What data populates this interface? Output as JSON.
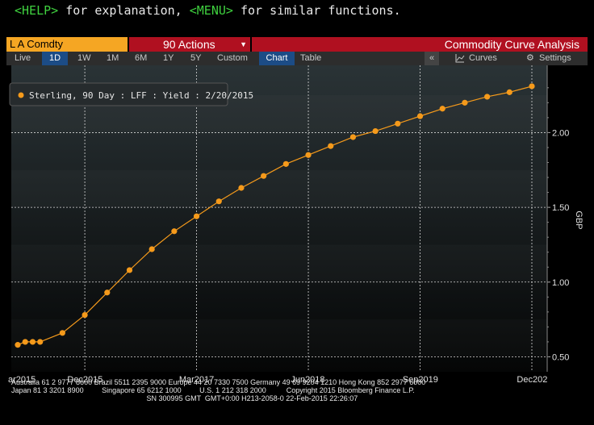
{
  "help_bar": {
    "help_key": "<HELP>",
    "help_text": " for explanation, ",
    "menu_key": "<MENU>",
    "menu_text": " for similar functions."
  },
  "header": {
    "ticker": "L A Comdty",
    "actions_num": "90",
    "actions_label": "Actions",
    "title": "Commodity Curve Analysis"
  },
  "toolbar": {
    "ranges": [
      "Live",
      "1D",
      "1W",
      "1M",
      "6M",
      "1Y",
      "5Y",
      "Custom"
    ],
    "active_range": "1D",
    "chart_label": "Chart",
    "table_label": "Table",
    "collapse_label": "«",
    "curves_label": "Curves",
    "settings_label": "Settings"
  },
  "legend": {
    "label": "Sterling, 90 Day : LFF : Yield : 2/20/2015"
  },
  "chart_data": {
    "type": "line",
    "ylabel": "GBP",
    "ylim": [
      0.4,
      2.45
    ],
    "y_ticks": [
      "0.50",
      "1.00",
      "1.50",
      "2.00"
    ],
    "x_ticks": [
      "ar2015",
      "Dec2015",
      "Mar2017",
      "Jun2018",
      "Sep2019",
      "Dec202"
    ],
    "series": [
      {
        "name": "Sterling, 90 Day : LFF : Yield : 2/20/2015",
        "color": "#f59a1b",
        "x": [
          "Mar2015",
          "Apr2015",
          "May2015",
          "Jun2015",
          "Sep2015",
          "Dec2015",
          "Mar2016",
          "Jun2016",
          "Sep2016",
          "Dec2016",
          "Mar2017",
          "Jun2017",
          "Sep2017",
          "Dec2017",
          "Mar2018",
          "Jun2018",
          "Sep2018",
          "Dec2018",
          "Mar2019",
          "Jun2019",
          "Sep2019",
          "Dec2019",
          "Mar2020",
          "Jun2020",
          "Sep2020",
          "Dec2020"
        ],
        "values": [
          0.58,
          0.6,
          0.6,
          0.6,
          0.66,
          0.78,
          0.93,
          1.08,
          1.22,
          1.34,
          1.44,
          1.54,
          1.63,
          1.71,
          1.79,
          1.85,
          1.91,
          1.97,
          2.01,
          2.06,
          2.11,
          2.16,
          2.2,
          2.24,
          2.27,
          2.31
        ]
      }
    ]
  },
  "footer": {
    "line1": "Australia 61 2 9777 8600 Brazil 5511 2395 9000 Europe 44 20 7330 7500 Germany 49 69 9204 1210 Hong Kong 852 2977 6000",
    "line2": "Japan 81 3 3201 8900         Singapore 65 6212 1000         U.S. 1 212 318 2000          Copyright 2015 Bloomberg Finance L.P.",
    "line3": "                                                                   SN 300995 GMT  GMT+0:00 H213-2058-0 22-Feb-2015 22:26:07"
  }
}
